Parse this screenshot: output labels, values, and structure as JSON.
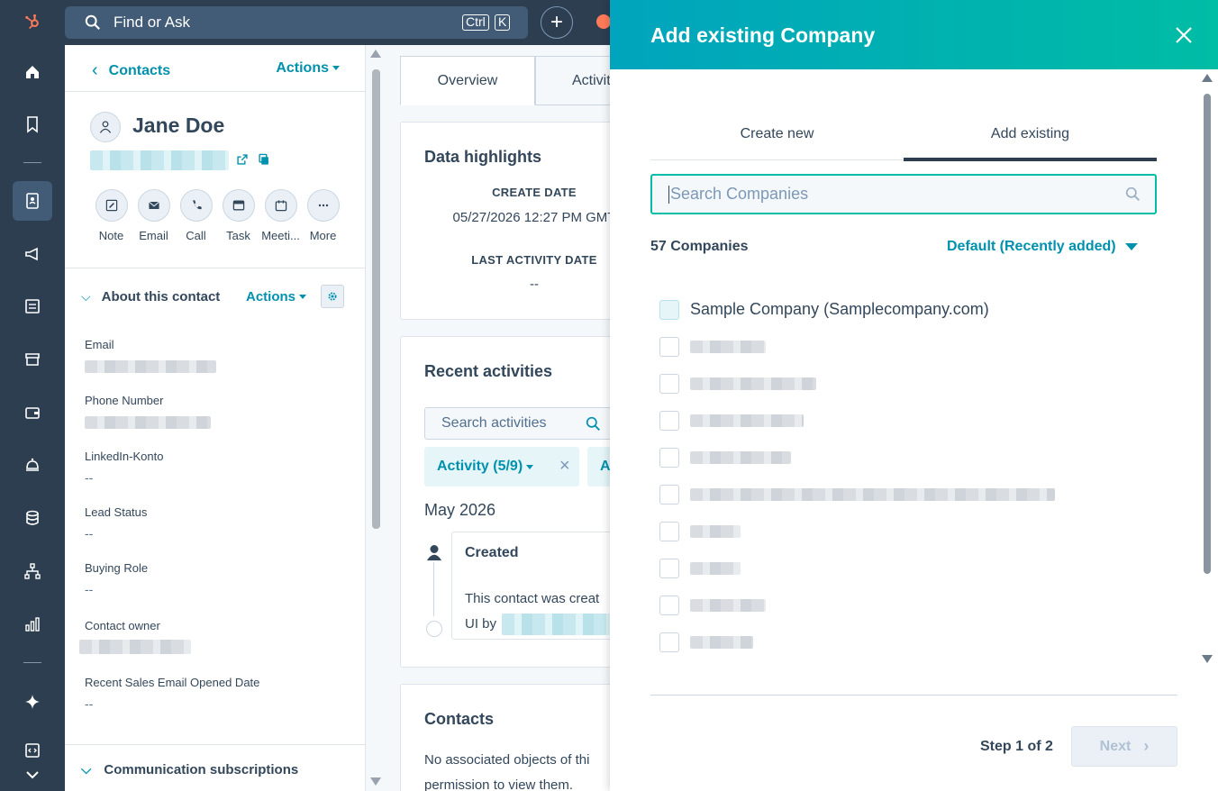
{
  "topbar": {
    "search_label": "Find or Ask",
    "kbd_ctrl": "Ctrl",
    "kbd_k": "K",
    "plus": "+"
  },
  "contact": {
    "back_label": "Contacts",
    "actions_label": "Actions",
    "name": "Jane Doe",
    "quick_actions": [
      {
        "label": "Note"
      },
      {
        "label": "Email"
      },
      {
        "label": "Call"
      },
      {
        "label": "Task"
      },
      {
        "label": "Meeti..."
      },
      {
        "label": "More"
      }
    ],
    "about_title": "About this contact",
    "about_actions": "Actions",
    "properties": [
      {
        "label": "Email",
        "value": ""
      },
      {
        "label": "Phone Number",
        "value": ""
      },
      {
        "label": "LinkedIn-Konto",
        "value": "--"
      },
      {
        "label": "Lead Status",
        "value": "--"
      },
      {
        "label": "Buying Role",
        "value": "--"
      },
      {
        "label": "Contact owner",
        "value": ""
      },
      {
        "label": "Recent Sales Email Opened Date",
        "value": "--"
      }
    ],
    "comm_title": "Communication subscriptions"
  },
  "middle": {
    "tabs": [
      "Overview",
      "Activiti"
    ],
    "data_highlights": {
      "title": "Data highlights",
      "create_date_label": "CREATE DATE",
      "create_date_value": "05/27/2026 12:27 PM GMT",
      "last_activity_label": "LAST ACTIVITY DATE",
      "last_activity_value": "--"
    },
    "recent": {
      "title": "Recent activities",
      "search_placeholder": "Search activities",
      "filter_chip": "Activity (5/9)",
      "filter_chip2": "Al",
      "month": "May 2026",
      "event_title": "Created",
      "event_line1": "This contact was creat",
      "event_line2": "UI by"
    },
    "contacts_card": {
      "title": "Contacts",
      "line1": "No associated objects of thi",
      "line2": "permission to view them."
    }
  },
  "modal": {
    "title": "Add existing Company",
    "tabs": [
      "Create new",
      "Add existing"
    ],
    "search_placeholder": "Search Companies",
    "count_label": "57 Companies",
    "sort_label": "Default (Recently added)",
    "companies": [
      {
        "name": "Sample Company (Samplecompany.com)"
      }
    ],
    "step_label": "Step 1 of 2",
    "next_label": "Next"
  },
  "colors": {
    "nav_bg": "#2d3e50",
    "accent_teal": "#0091ae",
    "header_gradient_start": "#00a4bd",
    "header_gradient_end": "#00bda5"
  }
}
